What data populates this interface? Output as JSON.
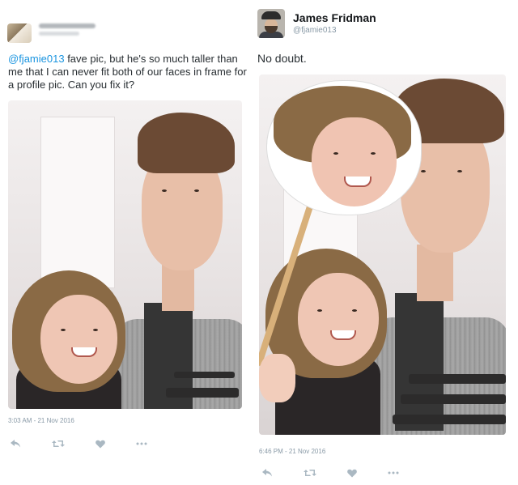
{
  "original_tweet": {
    "text_mention": "@fjamie013",
    "text_body": " fave pic, but he's so much taller than me that I can never fit both of our faces in frame for a profile pic. Can you fix it?",
    "timestamp": "3:03 AM - 21 Nov 2016",
    "actions": [
      {
        "icon": "reply-icon"
      },
      {
        "icon": "retweet-icon"
      },
      {
        "icon": "like-icon"
      },
      {
        "icon": "more-icon"
      }
    ]
  },
  "reply_tweet": {
    "display_name": "James Fridman",
    "handle": "@fjamie013",
    "text": "No doubt.",
    "timestamp": "6:46 PM - 21 Nov 2016",
    "actions": [
      {
        "icon": "reply-icon"
      },
      {
        "icon": "retweet-icon"
      },
      {
        "icon": "like-icon"
      },
      {
        "icon": "more-icon"
      }
    ]
  },
  "colors": {
    "mention": "#1b95e0",
    "meta": "#8899a6",
    "action_icon": "#aab8c2"
  }
}
